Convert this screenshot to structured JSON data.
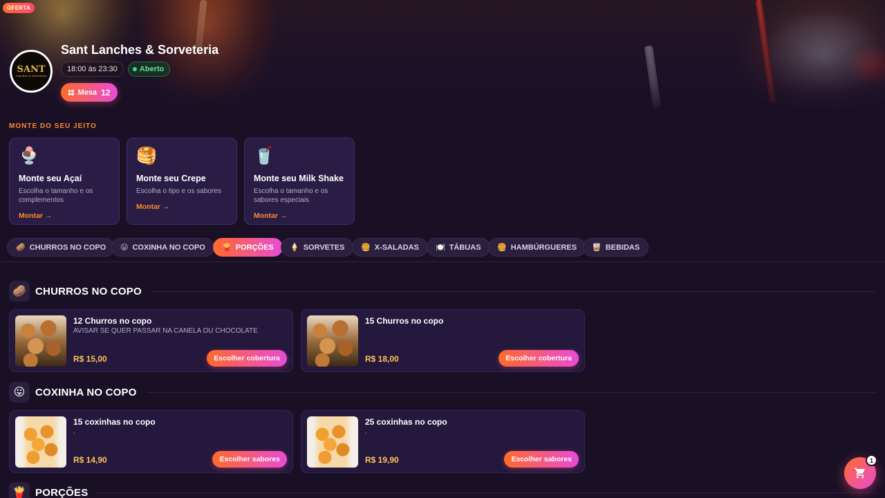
{
  "header": {
    "badge": "OFERTA",
    "store_name": "Sant Lanches & Sorveteria",
    "hours": "18:00 às 23:30",
    "status": "Aberto",
    "table_label": "Mesa",
    "table_number": "12",
    "logo_text": "SANT",
    "logo_subtext": "Lanches & Sorveteria"
  },
  "build": {
    "label": "MONTE DO SEU JEITO",
    "cards": [
      {
        "emoji": "🍨",
        "title": "Monte seu Açaí",
        "desc": "Escolha o tamanho e os complementos",
        "link": "Montar →"
      },
      {
        "emoji": "🥞",
        "title": "Monte seu Crepe",
        "desc": "Escolha o tipo e os sabores",
        "link": "Montar →"
      },
      {
        "emoji": "🥤",
        "title": "Monte seu Milk Shake",
        "desc": "Escolha o tamanho e os sabores especiais",
        "link": "Montar →"
      }
    ]
  },
  "categories": [
    {
      "icon": "🥔",
      "label": "CHURROS NO COPO"
    },
    {
      "icon": "😛",
      "label": "COXINHA NO COPO"
    },
    {
      "icon": "🍟",
      "label": "PORÇÕES"
    },
    {
      "icon": "🍦",
      "label": "SORVETES"
    },
    {
      "icon": "🍔",
      "label": "X-SALADAS"
    },
    {
      "icon": "🍽️",
      "label": "TÁBUAS"
    },
    {
      "icon": "🍔",
      "label": "HAMBÚRGUERES"
    },
    {
      "icon": "🥃",
      "label": "BEBIDAS"
    }
  ],
  "active_category": "PORÇÕES",
  "sections": [
    {
      "icon": "🥔",
      "title": "CHURROS NO COPO",
      "products": [
        {
          "name": "12 Churros no copo",
          "desc": "AVISAR SE QUER PASSAR NA CANELA OU CHOCOLATE",
          "price": "R$ 15,00",
          "button": "Escolher cobertura"
        },
        {
          "name": "15 Churros no copo",
          "desc": "",
          "price": "R$ 18,00",
          "button": "Escolher cobertura"
        }
      ]
    },
    {
      "icon": "😛",
      "title": "COXINHA NO COPO",
      "products": [
        {
          "name": "15 coxinhas no copo",
          "desc": ".",
          "price": "R$ 14,90",
          "button": "Escolher sabores"
        },
        {
          "name": "25 coxinhas no copo",
          "desc": ".",
          "price": "R$ 19,90",
          "button": "Escolher sabores"
        }
      ]
    },
    {
      "icon": "🍟",
      "title": "PORÇÕES",
      "products": []
    }
  ],
  "cart": {
    "count": "1",
    "icon": "cart-icon"
  },
  "colors": {
    "accent_orange": "#ff6a2b",
    "accent_pink": "#e94bd6",
    "price": "#ffc25a",
    "background": "#1a1026"
  }
}
